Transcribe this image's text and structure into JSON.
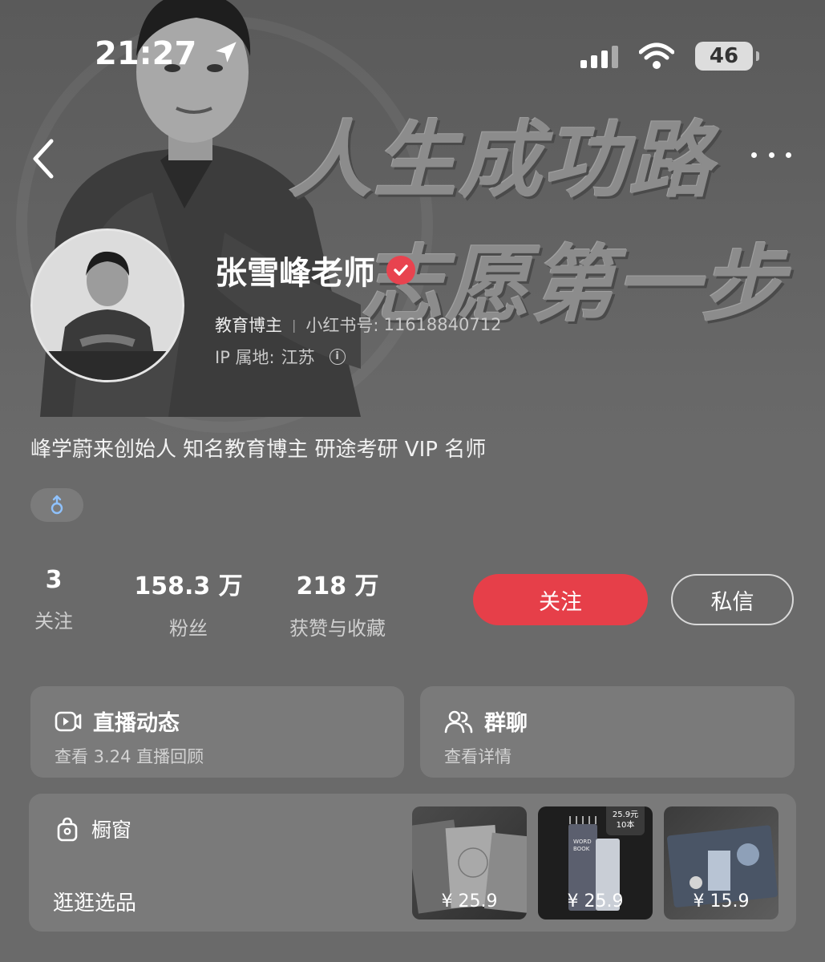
{
  "status_bar": {
    "time": "21:27",
    "battery": "46"
  },
  "cover": {
    "headline_1": "人生成功路",
    "headline_2": "志愿第一步"
  },
  "profile": {
    "name": "张雪峰老师",
    "role": "教育博主",
    "id_label": "小红书号:",
    "id_value": "11618840712",
    "ip_label": "IP 属地:",
    "ip_value": "江苏",
    "bio": "峰学蔚来创始人 知名教育博主 研途考研 VIP 名师",
    "gender_icon": "male-icon"
  },
  "stats": {
    "following": {
      "value": "3",
      "label": "关注"
    },
    "fans": {
      "value": "158.3 万",
      "label": "粉丝"
    },
    "likes": {
      "value": "218 万",
      "label": "获赞与收藏"
    }
  },
  "actions": {
    "follow": "关注",
    "message": "私信"
  },
  "cards": {
    "live": {
      "title": "直播动态",
      "subtitle": "查看 3.24 直播回顾",
      "icon": "live-video-icon"
    },
    "group": {
      "title": "群聊",
      "subtitle": "查看详情",
      "icon": "group-users-icon"
    },
    "shop": {
      "title": "橱窗",
      "subtitle": "逛逛选品",
      "icon": "shopping-bag-icon",
      "products": [
        {
          "price": "¥ 25.9"
        },
        {
          "price": "¥ 25.9",
          "badge": "25.9元 10本"
        },
        {
          "price": "¥ 15.9"
        }
      ]
    }
  },
  "colors": {
    "accent": "#e63f49",
    "verified": "#e8434f",
    "background": "#6a6a6a"
  }
}
